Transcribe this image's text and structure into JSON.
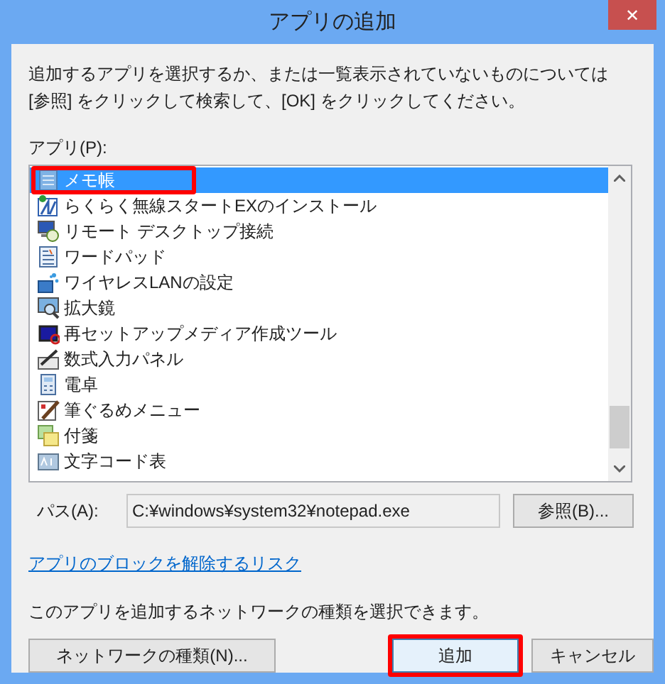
{
  "window": {
    "title": "アプリの追加",
    "close": "✕"
  },
  "instructions": "追加するアプリを選択するか、または一覧表示されていないものについては [参照] をクリックして検索して、[OK] をクリックしてください。",
  "apps_label": "アプリ(P):",
  "apps": [
    {
      "label": "メモ帳",
      "selected": true,
      "highlighted": true
    },
    {
      "label": "らくらく無線スタートEXのインストール",
      "selected": false,
      "highlighted": false
    },
    {
      "label": "リモート デスクトップ接続",
      "selected": false,
      "highlighted": false
    },
    {
      "label": "ワードパッド",
      "selected": false,
      "highlighted": false
    },
    {
      "label": "ワイヤレスLANの設定",
      "selected": false,
      "highlighted": false
    },
    {
      "label": "拡大鏡",
      "selected": false,
      "highlighted": false
    },
    {
      "label": "再セットアップメディア作成ツール",
      "selected": false,
      "highlighted": false
    },
    {
      "label": "数式入力パネル",
      "selected": false,
      "highlighted": false
    },
    {
      "label": "電卓",
      "selected": false,
      "highlighted": false
    },
    {
      "label": "筆ぐるめメニュー",
      "selected": false,
      "highlighted": false
    },
    {
      "label": "付箋",
      "selected": false,
      "highlighted": false
    },
    {
      "label": "文字コード表",
      "selected": false,
      "highlighted": false
    }
  ],
  "path": {
    "label": "パス(A):",
    "value": "C:¥windows¥system32¥notepad.exe"
  },
  "browse_button": "参照(B)...",
  "link": "アプリのブロックを解除するリスク",
  "network_note": "このアプリを追加するネットワークの種類を選択できます。",
  "buttons": [
    {
      "label": "ネットワークの種類(N)...",
      "highlighted": false
    },
    {
      "label": "追加",
      "highlighted": true
    },
    {
      "label": "キャンセル",
      "highlighted": false
    }
  ]
}
